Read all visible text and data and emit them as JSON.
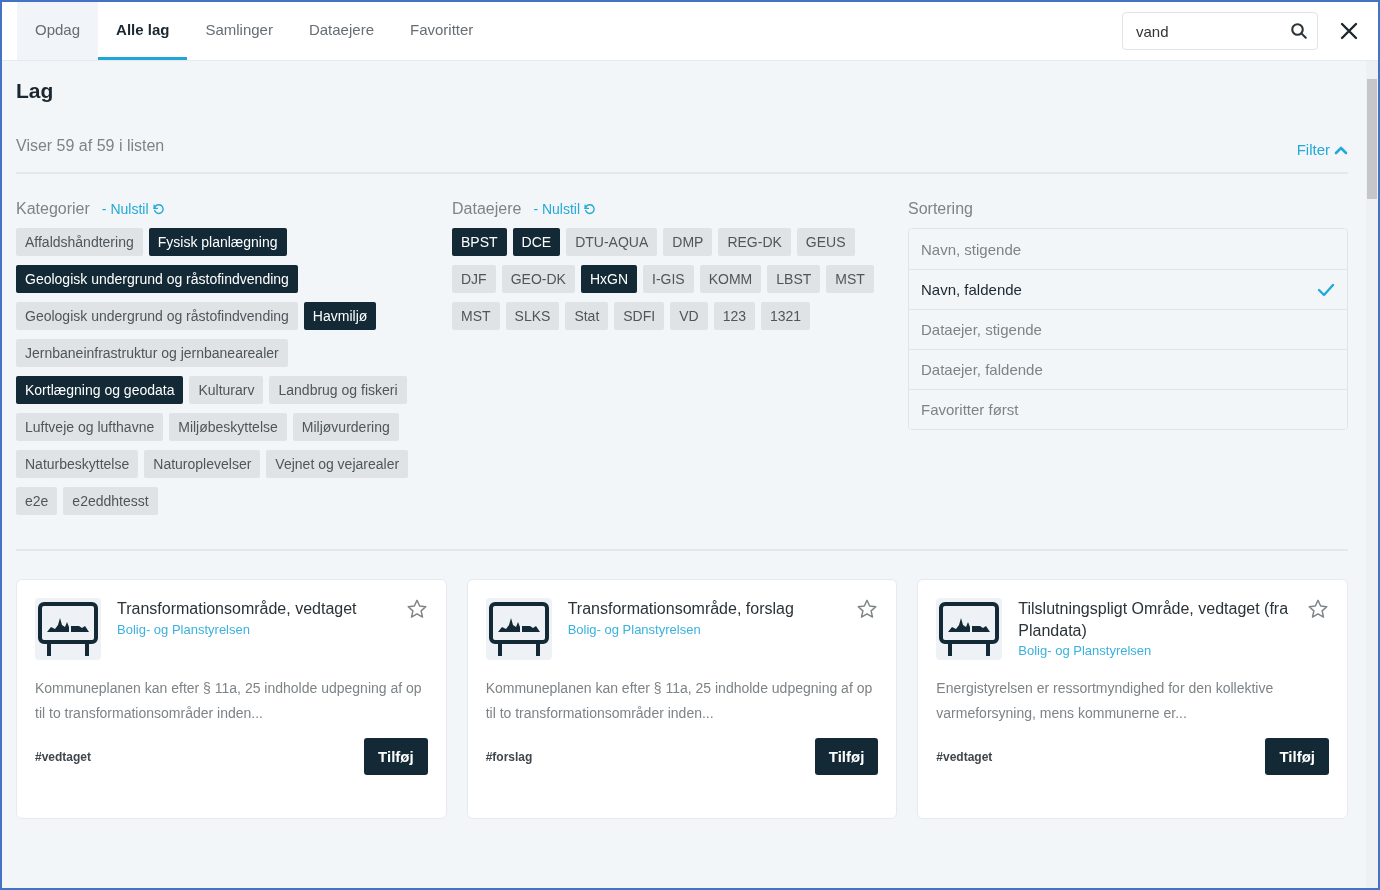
{
  "tabs": [
    {
      "label": "Opdag",
      "selected": false,
      "shaded": true
    },
    {
      "label": "Alle lag",
      "selected": true,
      "shaded": false
    },
    {
      "label": "Samlinger",
      "selected": false,
      "shaded": false
    },
    {
      "label": "Dataejere",
      "selected": false,
      "shaded": false
    },
    {
      "label": "Favoritter",
      "selected": false,
      "shaded": false
    }
  ],
  "search": {
    "value": "vand"
  },
  "heading": "Lag",
  "count": "Viser 59 af 59 i listen",
  "filter_toggle": {
    "label": "Filter",
    "expanded": true
  },
  "categories": {
    "title": "Kategorier",
    "reset": "- Nulstil",
    "chips": [
      {
        "label": "Affaldshåndtering",
        "selected": false
      },
      {
        "label": "Fysisk planlægning",
        "selected": true
      },
      {
        "label": "Geologisk undergrund og råstofindvending",
        "selected": true
      },
      {
        "label": "Geologisk undergrund og råstofindvending",
        "selected": false
      },
      {
        "label": "Havmiljø",
        "selected": true
      },
      {
        "label": "Jernbaneinfrastruktur og jernbanearealer",
        "selected": false
      },
      {
        "label": "Kortlægning og geodata",
        "selected": true
      },
      {
        "label": "Kulturarv",
        "selected": false
      },
      {
        "label": "Landbrug og fiskeri",
        "selected": false
      },
      {
        "label": "Luftveje og lufthavne",
        "selected": false
      },
      {
        "label": "Miljøbeskyttelse",
        "selected": false
      },
      {
        "label": "Miljøvurdering",
        "selected": false
      },
      {
        "label": "Naturbeskyttelse",
        "selected": false
      },
      {
        "label": "Naturoplevelser",
        "selected": false
      },
      {
        "label": "Vejnet og vejarealer",
        "selected": false
      },
      {
        "label": "e2e",
        "selected": false
      },
      {
        "label": "e2eddhtesst",
        "selected": false
      }
    ]
  },
  "owners": {
    "title": "Dataejere",
    "reset": "- Nulstil",
    "chips": [
      {
        "label": "BPST",
        "selected": true
      },
      {
        "label": "DCE",
        "selected": true
      },
      {
        "label": "DTU-AQUA",
        "selected": false
      },
      {
        "label": "DMP",
        "selected": false
      },
      {
        "label": "REG-DK",
        "selected": false
      },
      {
        "label": "GEUS",
        "selected": false
      },
      {
        "label": "DJF",
        "selected": false
      },
      {
        "label": "GEO-DK",
        "selected": false
      },
      {
        "label": "HxGN",
        "selected": true
      },
      {
        "label": "I-GIS",
        "selected": false
      },
      {
        "label": "KOMM",
        "selected": false
      },
      {
        "label": "LBST",
        "selected": false
      },
      {
        "label": "MST",
        "selected": false
      },
      {
        "label": "MST",
        "selected": false
      },
      {
        "label": "SLKS",
        "selected": false
      },
      {
        "label": "Stat",
        "selected": false
      },
      {
        "label": "SDFI",
        "selected": false
      },
      {
        "label": "VD",
        "selected": false
      },
      {
        "label": "123",
        "selected": false
      },
      {
        "label": "1321",
        "selected": false
      }
    ]
  },
  "sorting": {
    "title": "Sortering",
    "options": [
      {
        "label": "Navn, stigende",
        "selected": false
      },
      {
        "label": "Navn, faldende",
        "selected": true
      },
      {
        "label": "Dataejer, stigende",
        "selected": false
      },
      {
        "label": "Dataejer, faldende",
        "selected": false
      },
      {
        "label": "Favoritter først",
        "selected": false
      }
    ]
  },
  "cards": [
    {
      "title": "Transformationsområde, vedtaget",
      "owner": "Bolig- og Planstyrelsen",
      "description": "Kommuneplanen kan efter § 11a, 25 indholde udpegning af op til to transformationsområder inden...",
      "tag": "#vedtaget",
      "button": "Tilføj",
      "favorite": false
    },
    {
      "title": "Transformationsområde, forslag",
      "owner": "Bolig- og Planstyrelsen",
      "description": "Kommuneplanen kan efter § 11a, 25 indholde udpegning af op til to transformationsområder inden...",
      "tag": "#forslag",
      "button": "Tilføj",
      "favorite": false
    },
    {
      "title": "Tilslutningspligt Område, vedtaget (fra Plandata)",
      "owner": "Bolig- og Planstyrelsen",
      "description": "Energistyrelsen er ressortmyndighed for den kollektive varmeforsyning, mens kommunerne er...",
      "tag": "#vedtaget",
      "button": "Tilføj",
      "favorite": false
    }
  ]
}
